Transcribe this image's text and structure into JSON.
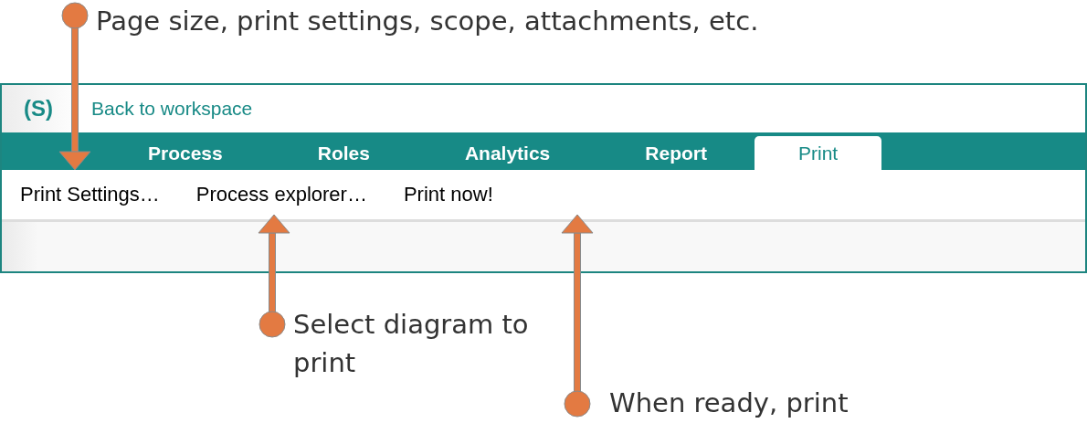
{
  "header": {
    "logo": "(S)",
    "back_link": "Back to workspace"
  },
  "tabs": [
    {
      "label": "Process",
      "selected": false
    },
    {
      "label": "Roles",
      "selected": false
    },
    {
      "label": "Analytics",
      "selected": false
    },
    {
      "label": "Report",
      "selected": false
    },
    {
      "label": "Print",
      "selected": true
    }
  ],
  "toolbar": [
    "Print Settings…",
    "Process explorer…",
    "Print now!"
  ],
  "annotations": [
    {
      "text": "Page size, print settings, scope, attachments, etc."
    },
    {
      "text": "Select diagram to print"
    },
    {
      "text": "When ready, print"
    }
  ]
}
